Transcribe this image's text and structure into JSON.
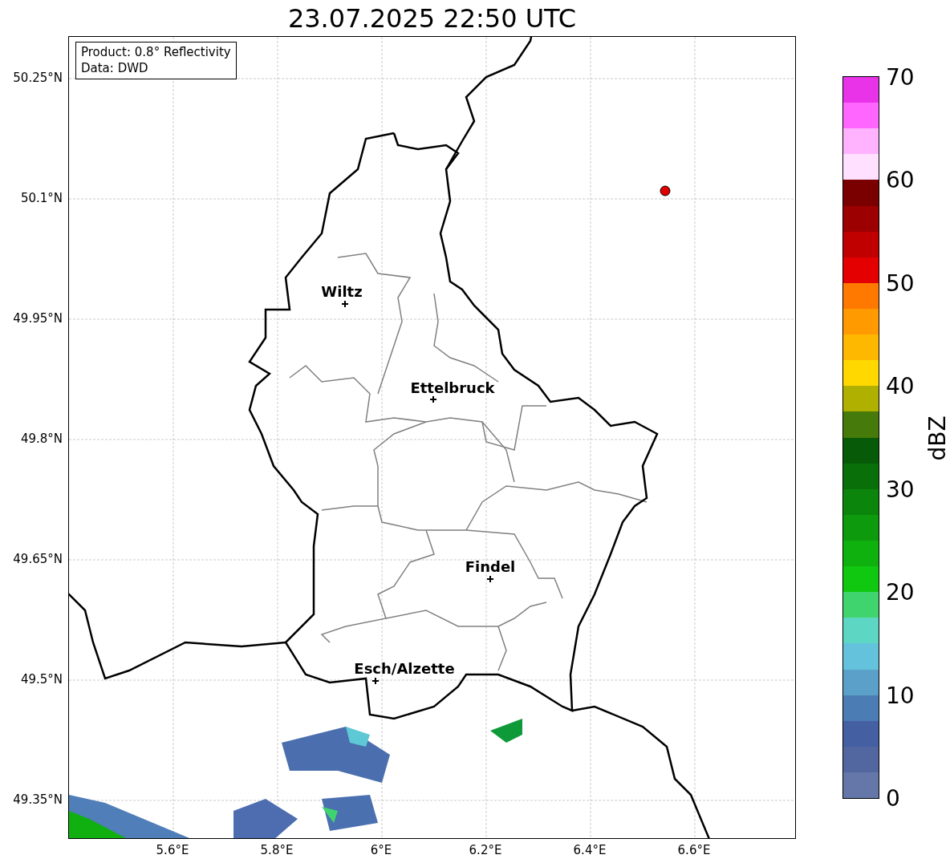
{
  "title": "23.07.2025 22:50 UTC",
  "info": [
    "Product: 0.8° Reflectivity",
    "Data: DWD"
  ],
  "cities": [
    {
      "name": "Wiltz"
    },
    {
      "name": "Ettelbruck"
    },
    {
      "name": "Findel"
    },
    {
      "name": "Esch/Alzette"
    }
  ],
  "lat_ticks": [
    "50.25°N",
    "50.1°N",
    "49.95°N",
    "49.8°N",
    "49.65°N",
    "49.5°N",
    "49.35°N"
  ],
  "lon_ticks": [
    "5.6°E",
    "5.8°E",
    "6°E",
    "6.2°E",
    "6.4°E",
    "6.6°E"
  ],
  "colorbar": {
    "label": "dBZ",
    "ticks": [
      "70",
      "60",
      "50",
      "40",
      "30",
      "20",
      "10",
      "0"
    ],
    "segments": [
      {
        "color": "#e833e8"
      },
      {
        "color": "#ff66ff"
      },
      {
        "color": "#ffb3ff"
      },
      {
        "color": "#ffe0ff"
      },
      {
        "color": "#7a0000"
      },
      {
        "color": "#9c0000"
      },
      {
        "color": "#c00000"
      },
      {
        "color": "#e40000"
      },
      {
        "color": "#ff7800"
      },
      {
        "color": "#ff9a00"
      },
      {
        "color": "#ffb800"
      },
      {
        "color": "#ffd800"
      },
      {
        "color": "#b0b000"
      },
      {
        "color": "#467a0a"
      },
      {
        "color": "#075a07"
      },
      {
        "color": "#097009"
      },
      {
        "color": "#0b850b"
      },
      {
        "color": "#0d9a0d"
      },
      {
        "color": "#0fb10f"
      },
      {
        "color": "#11c811"
      },
      {
        "color": "#3fd46e"
      },
      {
        "color": "#5ed6c4"
      },
      {
        "color": "#64c2dc"
      },
      {
        "color": "#5aa0c8"
      },
      {
        "color": "#4b7db4"
      },
      {
        "color": "#455fa3"
      },
      {
        "color": "#5266a0"
      },
      {
        "color": "#6577a8"
      }
    ]
  }
}
